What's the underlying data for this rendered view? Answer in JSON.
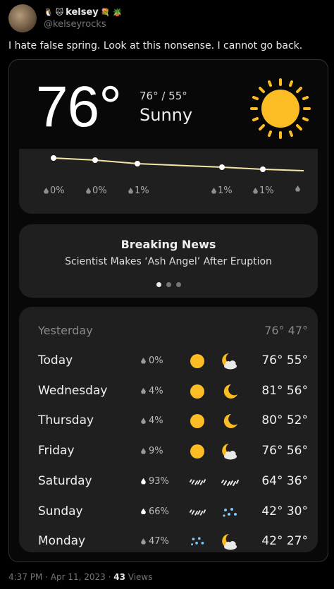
{
  "tweet": {
    "display_name": "kelsey",
    "handle": "@kelseyrocks",
    "text": "I hate false spring. Look at this nonsense. I cannot go back.",
    "time": "4:37 PM · Apr 11, 2023 · ",
    "views_count": "43",
    "views_label": " Views"
  },
  "weather": {
    "current_temp": "76°",
    "hi_lo": "76° / 55°",
    "condition": "Sunny",
    "hourly_precip": [
      "0%",
      "0%",
      "1%",
      "1%",
      "1%",
      ""
    ],
    "news_title": "Breaking News",
    "news_text": "Scientist Makes ‘Ash Angel’ After Eruption",
    "yesterday_label": "Yesterday",
    "yesterday_temps": "76° 47°",
    "days": [
      {
        "day": "Today",
        "precip": "0%",
        "day_icon": "sun-icon",
        "night_icon": "partly-cloudy-night-icon",
        "temps": "76° 55°"
      },
      {
        "day": "Wednesday",
        "precip": "4%",
        "day_icon": "sun-icon",
        "night_icon": "moon-icon",
        "temps": "81° 56°"
      },
      {
        "day": "Thursday",
        "precip": "4%",
        "day_icon": "sun-icon",
        "night_icon": "moon-icon",
        "temps": "80° 52°"
      },
      {
        "day": "Friday",
        "precip": "9%",
        "day_icon": "sun-icon",
        "night_icon": "partly-cloudy-night-icon",
        "temps": "76° 56°"
      },
      {
        "day": "Saturday",
        "precip": "93%",
        "day_icon": "rain-icon",
        "night_icon": "rain-icon",
        "temps": "64° 36°"
      },
      {
        "day": "Sunday",
        "precip": "66%",
        "day_icon": "rain-icon",
        "night_icon": "snow-icon",
        "temps": "42° 30°"
      },
      {
        "day": "Monday",
        "precip": "47%",
        "day_icon": "snow-icon",
        "night_icon": "partly-cloudy-night-icon",
        "temps": "42° 27°"
      }
    ]
  }
}
